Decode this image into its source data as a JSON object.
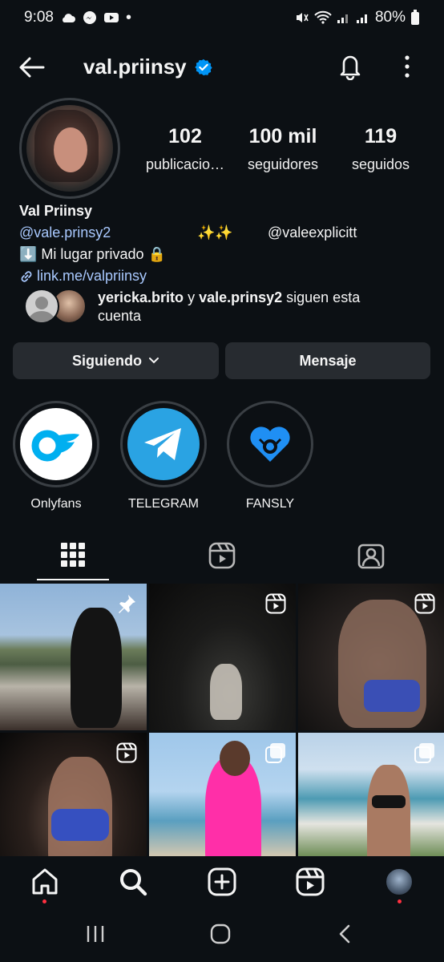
{
  "status_bar": {
    "time": "9:08",
    "battery": "80%"
  },
  "header": {
    "username": "val.priinsy"
  },
  "profile": {
    "stats": [
      {
        "value": "102",
        "label": "publicacio…"
      },
      {
        "value": "100 mil",
        "label": "seguidores"
      },
      {
        "value": "119",
        "label": "seguidos"
      }
    ],
    "name": "Val Priinsy",
    "bio_handle_1": "@vale.prinsy2",
    "bio_sparkles": "✨✨",
    "bio_handle_2": "@valeexplicitt",
    "bio_line_2": "⬇️ Mi lugar privado 🔒",
    "bio_link": "link.me/valpriinsy",
    "followed_by": {
      "user1": "yericka.brito",
      "and": " y ",
      "user2": "vale.prinsy2",
      "rest": " siguen esta cuenta"
    }
  },
  "buttons": {
    "following": "Siguiendo",
    "message": "Mensaje"
  },
  "highlights": [
    {
      "label": "Onlyfans",
      "icon": "onlyfans-icon"
    },
    {
      "label": "TELEGRAM",
      "icon": "telegram-icon"
    },
    {
      "label": "FANSLY",
      "icon": "fansly-icon"
    }
  ],
  "colors": {
    "background": "#0c1014",
    "button": "#272b30",
    "link": "#a9c9ff",
    "verified": "#0095f6",
    "telegram": "#2aa3e3",
    "onlyfans": "#00aff0",
    "fansly": "#1f8ff4"
  }
}
